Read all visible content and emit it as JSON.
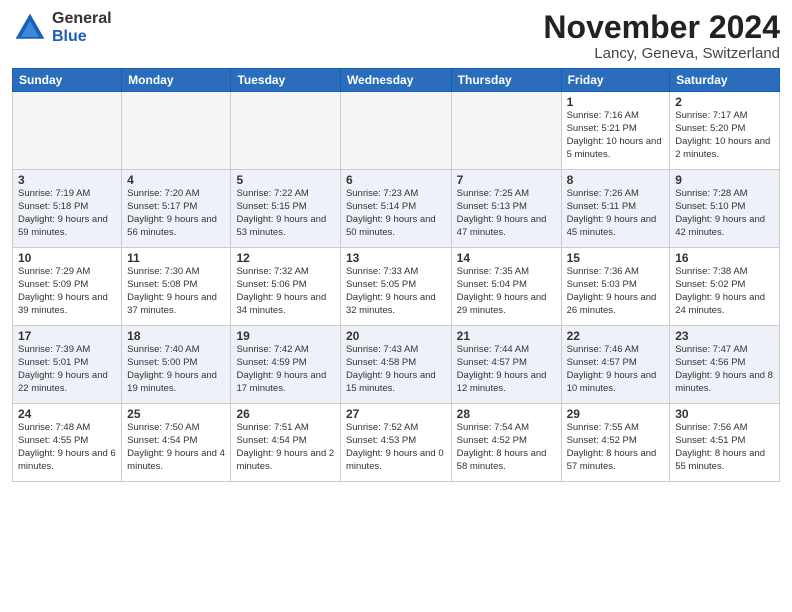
{
  "header": {
    "logo_general": "General",
    "logo_blue": "Blue",
    "month_title": "November 2024",
    "location": "Lancy, Geneva, Switzerland"
  },
  "weekdays": [
    "Sunday",
    "Monday",
    "Tuesday",
    "Wednesday",
    "Thursday",
    "Friday",
    "Saturday"
  ],
  "weeks": [
    [
      {
        "day": "",
        "info": ""
      },
      {
        "day": "",
        "info": ""
      },
      {
        "day": "",
        "info": ""
      },
      {
        "day": "",
        "info": ""
      },
      {
        "day": "",
        "info": ""
      },
      {
        "day": "1",
        "info": "Sunrise: 7:16 AM\nSunset: 5:21 PM\nDaylight: 10 hours\nand 5 minutes."
      },
      {
        "day": "2",
        "info": "Sunrise: 7:17 AM\nSunset: 5:20 PM\nDaylight: 10 hours\nand 2 minutes."
      }
    ],
    [
      {
        "day": "3",
        "info": "Sunrise: 7:19 AM\nSunset: 5:18 PM\nDaylight: 9 hours\nand 59 minutes."
      },
      {
        "day": "4",
        "info": "Sunrise: 7:20 AM\nSunset: 5:17 PM\nDaylight: 9 hours\nand 56 minutes."
      },
      {
        "day": "5",
        "info": "Sunrise: 7:22 AM\nSunset: 5:15 PM\nDaylight: 9 hours\nand 53 minutes."
      },
      {
        "day": "6",
        "info": "Sunrise: 7:23 AM\nSunset: 5:14 PM\nDaylight: 9 hours\nand 50 minutes."
      },
      {
        "day": "7",
        "info": "Sunrise: 7:25 AM\nSunset: 5:13 PM\nDaylight: 9 hours\nand 47 minutes."
      },
      {
        "day": "8",
        "info": "Sunrise: 7:26 AM\nSunset: 5:11 PM\nDaylight: 9 hours\nand 45 minutes."
      },
      {
        "day": "9",
        "info": "Sunrise: 7:28 AM\nSunset: 5:10 PM\nDaylight: 9 hours\nand 42 minutes."
      }
    ],
    [
      {
        "day": "10",
        "info": "Sunrise: 7:29 AM\nSunset: 5:09 PM\nDaylight: 9 hours\nand 39 minutes."
      },
      {
        "day": "11",
        "info": "Sunrise: 7:30 AM\nSunset: 5:08 PM\nDaylight: 9 hours\nand 37 minutes."
      },
      {
        "day": "12",
        "info": "Sunrise: 7:32 AM\nSunset: 5:06 PM\nDaylight: 9 hours\nand 34 minutes."
      },
      {
        "day": "13",
        "info": "Sunrise: 7:33 AM\nSunset: 5:05 PM\nDaylight: 9 hours\nand 32 minutes."
      },
      {
        "day": "14",
        "info": "Sunrise: 7:35 AM\nSunset: 5:04 PM\nDaylight: 9 hours\nand 29 minutes."
      },
      {
        "day": "15",
        "info": "Sunrise: 7:36 AM\nSunset: 5:03 PM\nDaylight: 9 hours\nand 26 minutes."
      },
      {
        "day": "16",
        "info": "Sunrise: 7:38 AM\nSunset: 5:02 PM\nDaylight: 9 hours\nand 24 minutes."
      }
    ],
    [
      {
        "day": "17",
        "info": "Sunrise: 7:39 AM\nSunset: 5:01 PM\nDaylight: 9 hours\nand 22 minutes."
      },
      {
        "day": "18",
        "info": "Sunrise: 7:40 AM\nSunset: 5:00 PM\nDaylight: 9 hours\nand 19 minutes."
      },
      {
        "day": "19",
        "info": "Sunrise: 7:42 AM\nSunset: 4:59 PM\nDaylight: 9 hours\nand 17 minutes."
      },
      {
        "day": "20",
        "info": "Sunrise: 7:43 AM\nSunset: 4:58 PM\nDaylight: 9 hours\nand 15 minutes."
      },
      {
        "day": "21",
        "info": "Sunrise: 7:44 AM\nSunset: 4:57 PM\nDaylight: 9 hours\nand 12 minutes."
      },
      {
        "day": "22",
        "info": "Sunrise: 7:46 AM\nSunset: 4:57 PM\nDaylight: 9 hours\nand 10 minutes."
      },
      {
        "day": "23",
        "info": "Sunrise: 7:47 AM\nSunset: 4:56 PM\nDaylight: 9 hours\nand 8 minutes."
      }
    ],
    [
      {
        "day": "24",
        "info": "Sunrise: 7:48 AM\nSunset: 4:55 PM\nDaylight: 9 hours\nand 6 minutes."
      },
      {
        "day": "25",
        "info": "Sunrise: 7:50 AM\nSunset: 4:54 PM\nDaylight: 9 hours\nand 4 minutes."
      },
      {
        "day": "26",
        "info": "Sunrise: 7:51 AM\nSunset: 4:54 PM\nDaylight: 9 hours\nand 2 minutes."
      },
      {
        "day": "27",
        "info": "Sunrise: 7:52 AM\nSunset: 4:53 PM\nDaylight: 9 hours\nand 0 minutes."
      },
      {
        "day": "28",
        "info": "Sunrise: 7:54 AM\nSunset: 4:52 PM\nDaylight: 8 hours\nand 58 minutes."
      },
      {
        "day": "29",
        "info": "Sunrise: 7:55 AM\nSunset: 4:52 PM\nDaylight: 8 hours\nand 57 minutes."
      },
      {
        "day": "30",
        "info": "Sunrise: 7:56 AM\nSunset: 4:51 PM\nDaylight: 8 hours\nand 55 minutes."
      }
    ]
  ]
}
